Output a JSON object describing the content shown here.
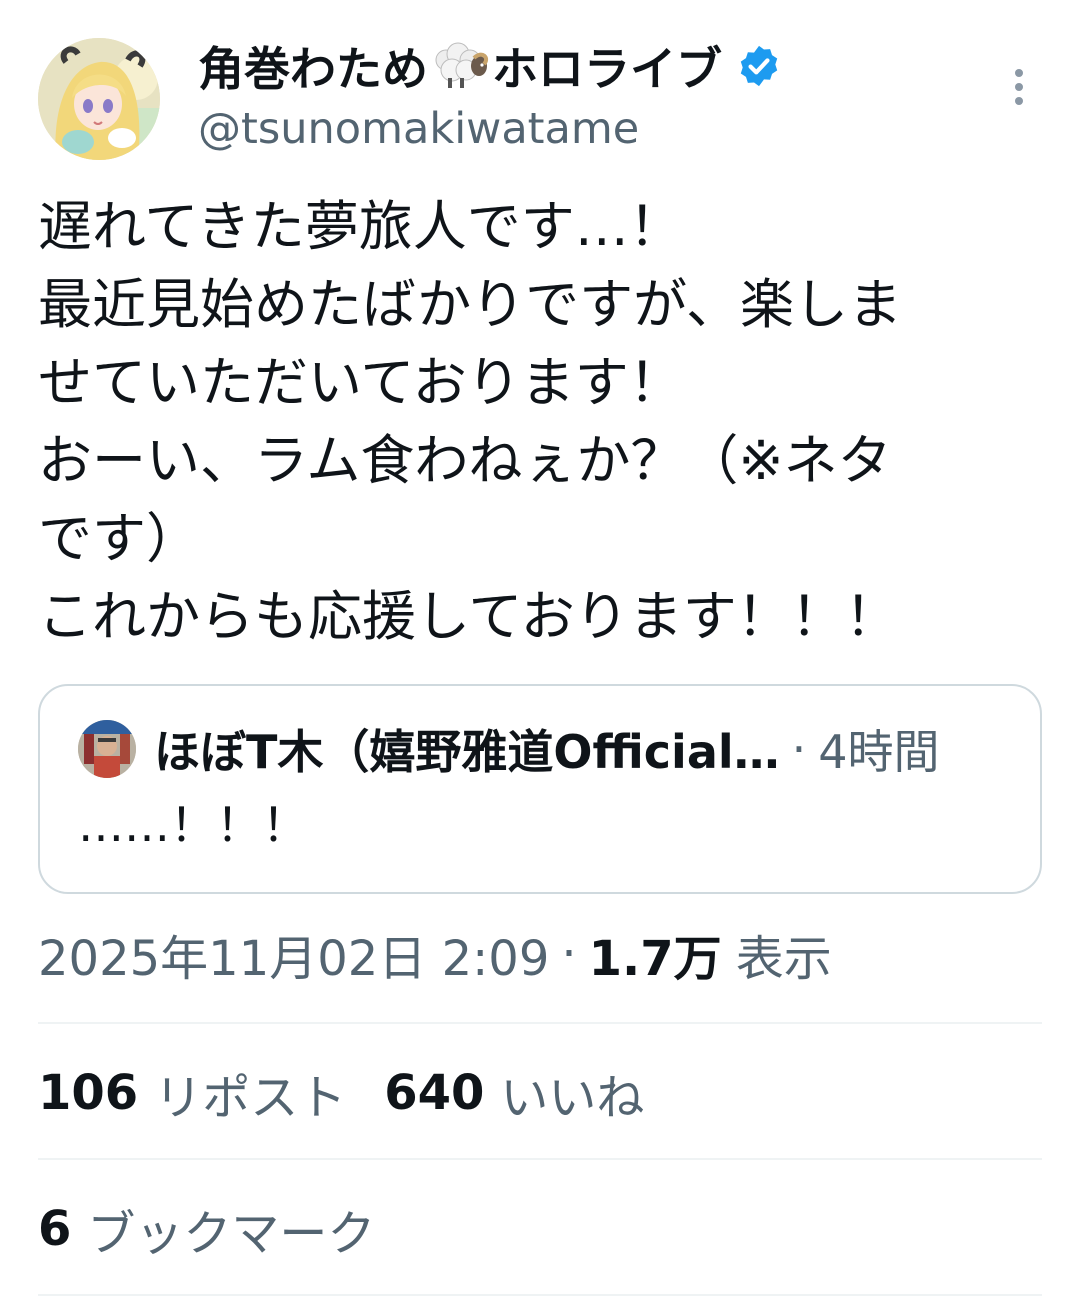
{
  "author": {
    "name_prefix": "角巻わため",
    "name_suffix": "ホロライブ",
    "handle": "@tsunomakiwatame",
    "verified": true,
    "emoji_icon": "sheep-icon",
    "verified_color": "#1d9bf0"
  },
  "tweet": {
    "lines": [
      "遅れてきた夢旅人です…！",
      "最近見始めたばかりですが、楽しま",
      "せていただいております！",
      "おーい、ラム食わねぇか？（※ネタ",
      "です）",
      "これからも応援しております！！！"
    ]
  },
  "quote": {
    "name": "ほぼT木（嬉野雅道Official…",
    "separator": "·",
    "time": "4時間",
    "text": "……！！！"
  },
  "meta": {
    "timestamp": "2025年11月02日 2:09",
    "separator": "·",
    "views": "1.7万",
    "views_label": "表示"
  },
  "stats": {
    "reposts_count": "106",
    "reposts_label": "リポスト",
    "likes_count": "640",
    "likes_label": "いいね",
    "bookmarks_count": "6",
    "bookmarks_label": "ブックマーク"
  },
  "colors": {
    "text_primary": "#0f1419",
    "text_secondary": "#536471",
    "border": "#cfd9de",
    "divider": "#eff3f4",
    "accent": "#1d9bf0"
  }
}
